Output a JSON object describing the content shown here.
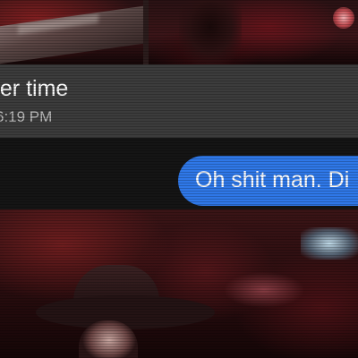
{
  "conversation": {
    "received_message": {
      "text": "ger time",
      "timestamp": "6:19 PM"
    },
    "sent_message": {
      "text": "Oh shit man. Di"
    }
  },
  "colors": {
    "received_band": "#3c3c3c",
    "sent_bubble": "#2f78e8",
    "background_dark": "#151515"
  },
  "images": [
    {
      "name": "photo-top",
      "description_icon": "photo-icon"
    },
    {
      "name": "photo-bottom",
      "description_icon": "photo-icon"
    }
  ]
}
